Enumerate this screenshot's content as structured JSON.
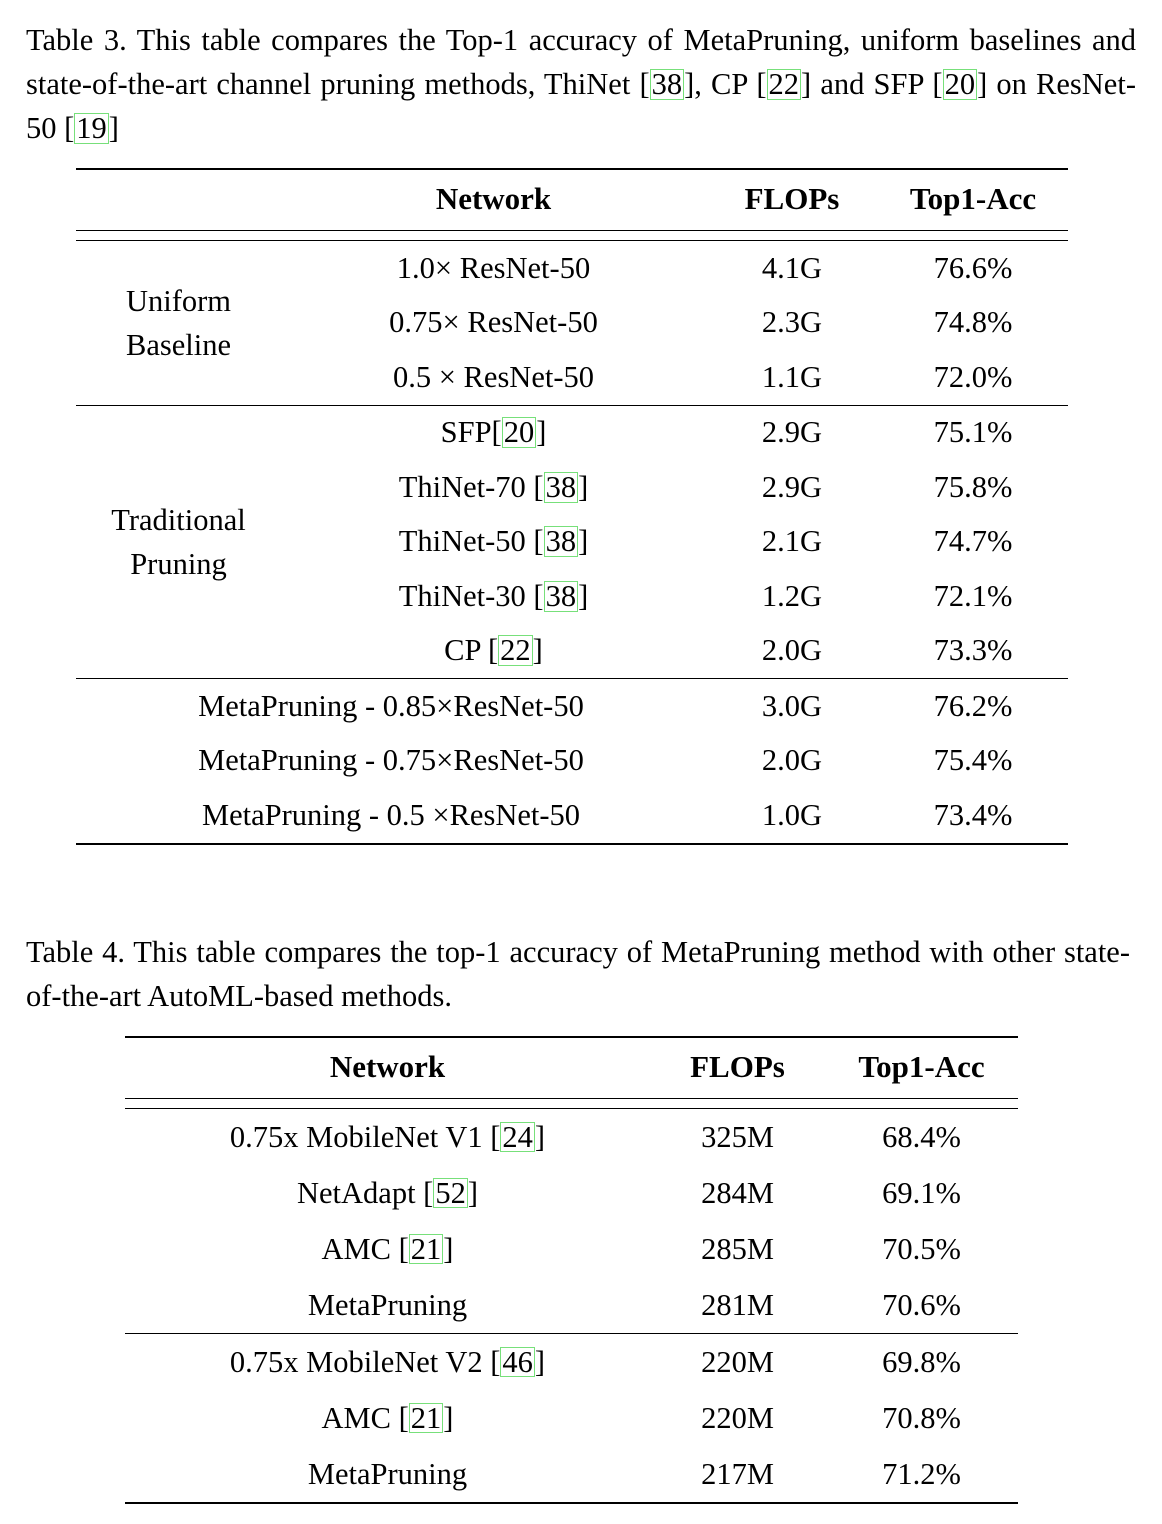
{
  "table3": {
    "caption": {
      "prefix": "Table 3. This table compares the Top-1 accuracy of MetaPruning, uniform baselines and state-of-the-art channel pruning methods, ThiNet [",
      "full_text": "Table 3. This table compares the Top-1 accuracy of MetaPruning, uniform baselines and state-of-the-art channel pruning methods, ThiNet [38], CP [22] and SFP [20] on ResNet-50 [19]",
      "seg1": "Table 3. This table compares the Top-1 accuracy of MetaPruning, uniform baselines and state-of-the-art channel pruning methods, ThiNet [",
      "cite1": "38",
      "seg2": "], CP [",
      "cite2": "22",
      "seg3": "] and SFP [",
      "cite3": "20",
      "seg4": "] on ResNet-50 [",
      "cite4": "19",
      "seg5": "]"
    },
    "headers": {
      "group": "",
      "network": "Network",
      "flops": "FLOPs",
      "acc": "Top1-Acc"
    },
    "groups": [
      {
        "label_line1": "Uniform",
        "label_line2": "Baseline",
        "rows": [
          {
            "network": "1.0× ResNet-50",
            "flops": "4.1G",
            "acc": "76.6%",
            "bold": false
          },
          {
            "network": "0.75× ResNet-50",
            "flops": "2.3G",
            "acc": "74.8%",
            "bold": false
          },
          {
            "network": "0.5 × ResNet-50",
            "flops": "1.1G",
            "acc": "72.0%",
            "bold": false
          }
        ]
      },
      {
        "label_line1": "Traditional",
        "label_line2": "Pruning",
        "rows": [
          {
            "network": "SFP[20]",
            "cite": "20",
            "pre": "SFP[",
            "post": "]",
            "flops": "2.9G",
            "acc": "75.1%",
            "bold": false
          },
          {
            "network": "ThiNet-70 [38]",
            "cite": "38",
            "pre": "ThiNet-70 [",
            "post": "]",
            "flops": "2.9G",
            "acc": "75.8%",
            "bold": false
          },
          {
            "network": "ThiNet-50 [38]",
            "cite": "38",
            "pre": "ThiNet-50 [",
            "post": "]",
            "flops": "2.1G",
            "acc": "74.7%",
            "bold": false
          },
          {
            "network": "ThiNet-30 [38]",
            "cite": "38",
            "pre": "ThiNet-30 [",
            "post": "]",
            "flops": "1.2G",
            "acc": "72.1%",
            "bold": false
          },
          {
            "network": "CP [22]",
            "cite": "22",
            "pre": "CP [",
            "post": "]",
            "flops": "2.0G",
            "acc": "73.3%",
            "bold": false
          }
        ]
      }
    ],
    "meta_rows": [
      {
        "network": "MetaPruning - 0.85×ResNet-50",
        "flops": "3.0G",
        "acc": "76.2%",
        "bold": true
      },
      {
        "network": "MetaPruning - 0.75×ResNet-50",
        "flops": "2.0G",
        "acc": "75.4%",
        "bold": true
      },
      {
        "network": "MetaPruning - 0.5 ×ResNet-50",
        "flops": "1.0G",
        "acc": "73.4%",
        "bold": true
      }
    ]
  },
  "table4": {
    "caption": {
      "full_text": "Table 4. This table compares the top-1 accuracy of MetaPruning method with other state-of-the-art AutoML-based methods."
    },
    "headers": {
      "network": "Network",
      "flops": "FLOPs",
      "acc": "Top1-Acc"
    },
    "sections": [
      {
        "rows": [
          {
            "pre": "0.75x MobileNet V1 [",
            "cite": "24",
            "post": "]",
            "network": "0.75x MobileNet V1 [24]",
            "flops": "325M",
            "acc": "68.4%",
            "bold": false
          },
          {
            "pre": "NetAdapt [",
            "cite": "52",
            "post": "]",
            "network": "NetAdapt [52]",
            "flops": "284M",
            "acc": "69.1%",
            "bold": false
          },
          {
            "pre": "AMC [",
            "cite": "21",
            "post": "]",
            "network": "AMC [21]",
            "flops": "285M",
            "acc": "70.5%",
            "bold": false
          },
          {
            "pre": "MetaPruning",
            "cite": "",
            "post": "",
            "network": "MetaPruning",
            "flops": "281M",
            "acc": "70.6%",
            "bold": true
          }
        ]
      },
      {
        "rows": [
          {
            "pre": "0.75x MobileNet V2 [",
            "cite": "46",
            "post": "]",
            "network": "0.75x MobileNet V2 [46]",
            "flops": "220M",
            "acc": "69.8%",
            "bold": false
          },
          {
            "pre": "AMC [",
            "cite": "21",
            "post": "]",
            "network": "AMC [21]",
            "flops": "220M",
            "acc": "70.8%",
            "bold": false
          },
          {
            "pre": "MetaPruning",
            "cite": "",
            "post": "",
            "network": "MetaPruning",
            "flops": "217M",
            "acc": "71.2%",
            "bold": true
          }
        ]
      }
    ]
  },
  "colors": {
    "text": "#000000",
    "background": "#ffffff",
    "citation_box": "#77e07a",
    "rule": "#000000"
  }
}
